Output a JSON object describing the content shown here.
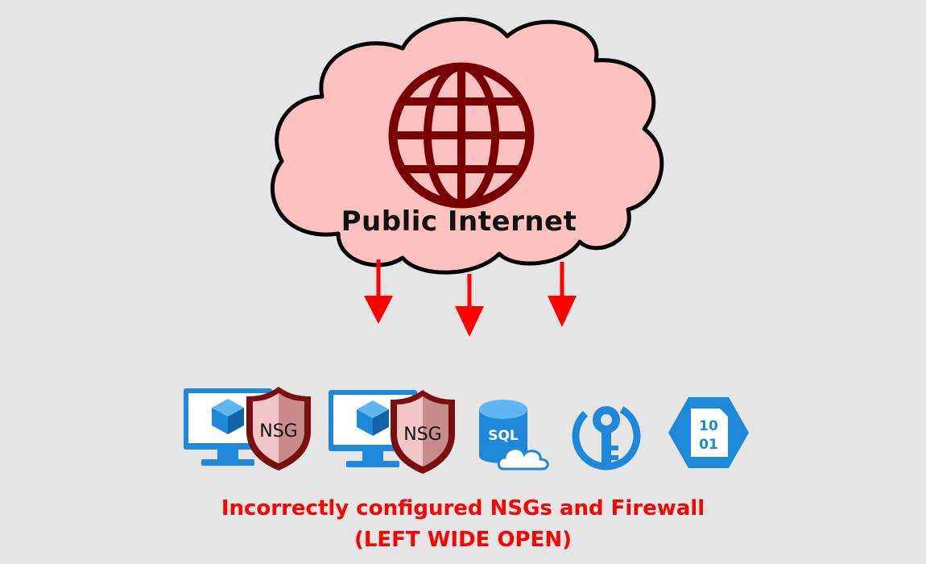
{
  "diagram": {
    "cloud_label": "Public Internet",
    "globe_icon": "globe-icon",
    "arrows": {
      "count": 3,
      "color": "#ff0000",
      "direction": "down"
    },
    "resources": [
      {
        "icon": "virtual-machine-icon",
        "badge_icon": "nsg-shield-icon",
        "badge_label": "NSG"
      },
      {
        "icon": "virtual-machine-icon",
        "badge_icon": "nsg-shield-icon",
        "badge_label": "NSG"
      },
      {
        "icon": "sql-database-icon",
        "label": "SQL"
      },
      {
        "icon": "key-vault-icon"
      },
      {
        "icon": "storage-blob-icon",
        "label_line1": "10",
        "label_line2": "01"
      }
    ],
    "caption_line1": "Incorrectly configured NSGs and Firewall",
    "caption_line2": "(LEFT WIDE OPEN)",
    "colors": {
      "background": "#e5e5e5",
      "cloud_fill": "#ffc0c0",
      "globe": "#7a0000",
      "arrow": "#ff0000",
      "azure_blue": "#1e88d9",
      "nsg_shield": "#7a0f12",
      "caption": "#ff0000"
    }
  }
}
